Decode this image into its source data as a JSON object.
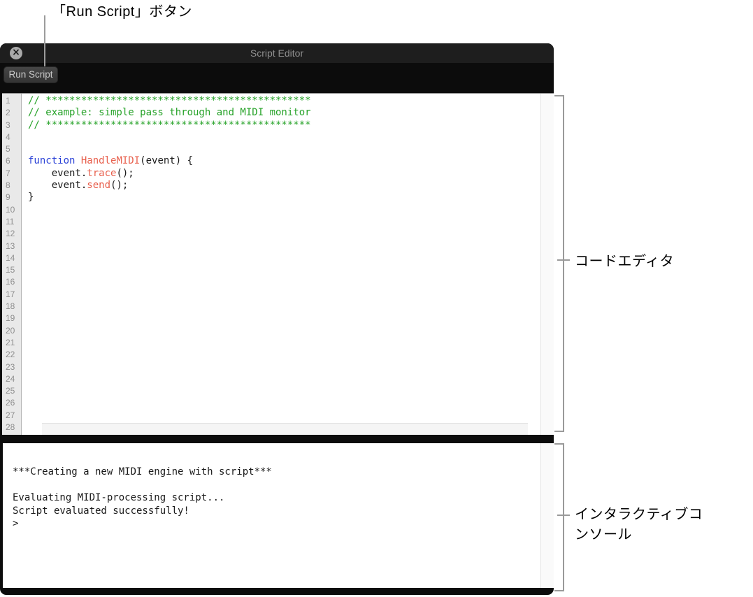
{
  "annotations": {
    "run_button_callout": "「Run Script」ボタン",
    "code_editor_callout": "コードエディタ",
    "console_callout": "インタラクティブコンソール"
  },
  "window": {
    "title": "Script Editor",
    "close_icon": "circle-x-close-icon",
    "run_button_label": "Run Script"
  },
  "editor": {
    "line_count": 28,
    "lines": [
      {
        "segments": [
          {
            "text": "// *********************************************",
            "style": "comment"
          }
        ]
      },
      {
        "segments": [
          {
            "text": "// example: simple pass through and MIDI monitor",
            "style": "comment"
          }
        ]
      },
      {
        "segments": [
          {
            "text": "// *********************************************",
            "style": "comment"
          }
        ]
      },
      {
        "segments": []
      },
      {
        "segments": []
      },
      {
        "segments": [
          {
            "text": "function",
            "style": "keyword"
          },
          {
            "text": " ",
            "style": "plain"
          },
          {
            "text": "HandleMIDI",
            "style": "fn"
          },
          {
            "text": "(event) {",
            "style": "plain"
          }
        ]
      },
      {
        "segments": [
          {
            "text": "    event.",
            "style": "plain"
          },
          {
            "text": "trace",
            "style": "fn"
          },
          {
            "text": "();",
            "style": "plain"
          }
        ]
      },
      {
        "segments": [
          {
            "text": "    event.",
            "style": "plain"
          },
          {
            "text": "send",
            "style": "fn"
          },
          {
            "text": "();",
            "style": "plain"
          }
        ]
      },
      {
        "segments": [
          {
            "text": "}",
            "style": "plain"
          }
        ]
      }
    ]
  },
  "console": {
    "lines": [
      "***Creating a new MIDI engine with script***",
      "",
      "Evaluating MIDI-processing script...",
      "Script evaluated successfully!",
      ">"
    ]
  },
  "colors": {
    "comment_green": "#26a228",
    "keyword_blue": "#2b42d7",
    "identifier_red": "#e8604d",
    "titlebar_bg": "#1e1e1e",
    "header_bg": "#0c0c0c",
    "gutter_bg": "#e9e9e9",
    "callout_gray": "#9a9a9a"
  }
}
